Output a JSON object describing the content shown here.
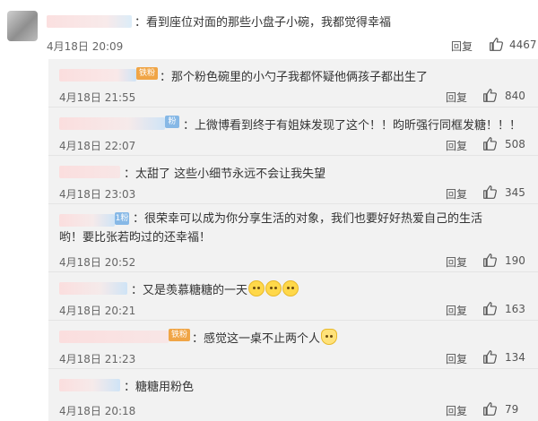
{
  "comment": {
    "text": "：看到座位对面的那些小盘子小碗，我都觉得幸福",
    "time": "4月18日 20:09",
    "reply_label": "回复",
    "likes": "4467"
  },
  "replies": [
    {
      "text": "：那个粉色碗里的小勺子我都怀疑他俩孩子都出生了",
      "time": "4月18日 21:55",
      "reply_label": "回复",
      "likes": "840",
      "badge": "铁粉"
    },
    {
      "text": "：上微博看到终于有姐妹发现了这个！！昀昕强行同框发糖！！！",
      "time": "4月18日 22:07",
      "reply_label": "回复",
      "likes": "508",
      "badge": "粉"
    },
    {
      "text": "：太甜了 这些小细节永远不会让我失望",
      "time": "4月18日 23:03",
      "reply_label": "回复",
      "likes": "345"
    },
    {
      "text": "：很荣幸可以成为你分享生活的对象，我们也要好好热爱自己的生活哟！要比张若昀过的还幸福！",
      "time": "4月18日 20:52",
      "reply_label": "回复",
      "likes": "190",
      "badge": "1粉"
    },
    {
      "text": "：又是羡慕糖糖的一天",
      "time": "4月18日 20:21",
      "reply_label": "回复",
      "likes": "163"
    },
    {
      "text": "：感觉这一桌不止两个人",
      "time": "4月18日 21:23",
      "reply_label": "回复",
      "likes": "134",
      "badge": "铁粉"
    },
    {
      "text": "：糖糖用粉色",
      "time": "4月18日 20:18",
      "reply_label": "回复",
      "likes": "79"
    }
  ]
}
